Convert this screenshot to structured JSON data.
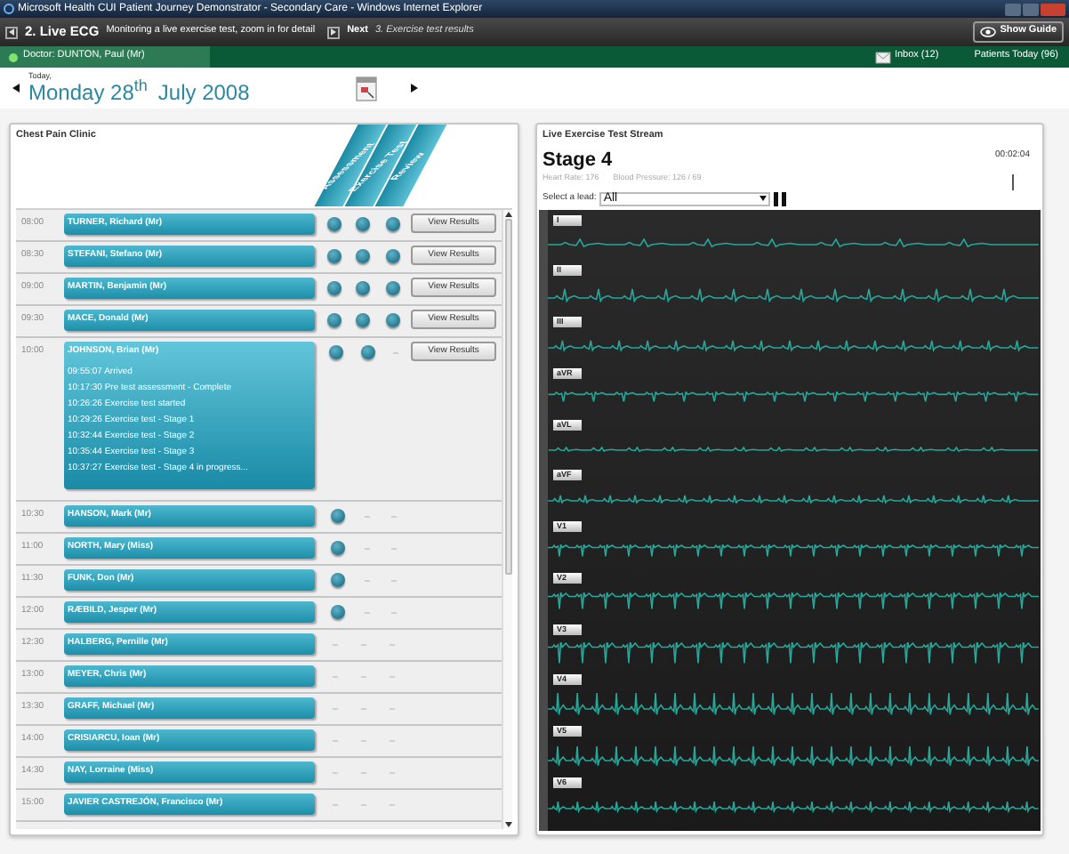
{
  "window": {
    "title": "Microsoft Health CUI Patient Journey Demonstrator - Secondary Care - Windows Internet Explorer"
  },
  "guide": {
    "step": "2. Live ECG",
    "description": "Monitoring a live exercise test, zoom in for detail",
    "next_label": "Next",
    "next_step": "3. Exercise test results",
    "show_guide": "Show Guide"
  },
  "status_bar": {
    "doctor": "Doctor: DUNTON, Paul (Mr)",
    "inbox": "Inbox (12)",
    "patients_today": "Patients Today (96)"
  },
  "date": {
    "today": "Today,",
    "day": "Monday 28$^{th}$",
    "month_year": "July 2008"
  },
  "clinic": {
    "title": "Chest Pain Clinic",
    "stages": [
      "Assessment",
      "Exercise Test",
      "Review"
    ],
    "appointments": [
      {
        "time": "08:00",
        "name": "TURNER, Richard (Mr)",
        "stages": [
          {
            "done": true
          },
          {
            "done": true
          },
          {
            "done": true
          }
        ],
        "action": "View Results",
        "expanded": false
      },
      {
        "time": "08:30",
        "name": "STEFANI, Stefano (Mr)",
        "stages": [
          {
            "done": true
          },
          {
            "done": true
          },
          {
            "done": true
          }
        ],
        "action": "View Results",
        "expanded": false
      },
      {
        "time": "09:00",
        "name": "MARTIN, Benjamin (Mr)",
        "stages": [
          {
            "done": true
          },
          {
            "done": true
          },
          {
            "done": true
          }
        ],
        "action": "View Results",
        "expanded": false
      },
      {
        "time": "09:30",
        "name": "MACE, Donald (Mr)",
        "stages": [
          {
            "done": true
          },
          {
            "done": true
          },
          {
            "done": true
          }
        ],
        "action": "View Results",
        "expanded": false
      },
      {
        "time": "10:00",
        "name": "JOHNSON, Brian (Mr)",
        "stages": [
          {
            "done": true
          },
          {
            "done": true
          },
          {
            "done": false
          }
        ],
        "action": "View Results",
        "expanded": true,
        "events": [
          "09:55:07 Arrived",
          "10:17:30 Pre test assessment - Complete",
          "10:26:26 Exercise test started",
          "10:29:26 Exercise test - Stage 1",
          "10:32:44 Exercise test - Stage 2",
          "10:35:44 Exercise test - Stage 3",
          "10:37:27 Exercise test - Stage 4 in progress..."
        ]
      },
      {
        "time": "10:30",
        "name": "HANSON, Mark (Mr)",
        "stages": [
          {
            "done": true
          },
          {
            "done": false
          },
          {
            "done": false
          }
        ],
        "expanded": false
      },
      {
        "time": "11:00",
        "name": "NORTH, Mary (Miss)",
        "stages": [
          {
            "done": true
          },
          {
            "done": false
          },
          {
            "done": false
          }
        ],
        "expanded": false
      },
      {
        "time": "11:30",
        "name": "FUNK, Don (Mr)",
        "stages": [
          {
            "done": true
          },
          {
            "done": false
          },
          {
            "done": false
          }
        ],
        "expanded": false
      },
      {
        "time": "12:00",
        "name": "RÆBILD, Jesper (Mr)",
        "stages": [
          {
            "done": true
          },
          {
            "done": false
          },
          {
            "done": false
          }
        ],
        "expanded": false
      },
      {
        "time": "12:30",
        "name": "HALBERG, Pernille (Mr)",
        "stages": [
          {
            "done": false
          },
          {
            "done": false
          },
          {
            "done": false
          }
        ],
        "expanded": false
      },
      {
        "time": "13:00",
        "name": "MEYER, Chris (Mr)",
        "stages": [
          {
            "done": false
          },
          {
            "done": false
          },
          {
            "done": false
          }
        ],
        "expanded": false
      },
      {
        "time": "13:30",
        "name": "GRAFF, Michael (Mr)",
        "stages": [
          {
            "done": false
          },
          {
            "done": false
          },
          {
            "done": false
          }
        ],
        "expanded": false
      },
      {
        "time": "14:00",
        "name": "CRISIARCU, Ioan (Mr)",
        "stages": [
          {
            "done": false
          },
          {
            "done": false
          },
          {
            "done": false
          }
        ],
        "expanded": false
      },
      {
        "time": "14:30",
        "name": "NAY, Lorraine (Miss)",
        "stages": [
          {
            "done": false
          },
          {
            "done": false
          },
          {
            "done": false
          }
        ],
        "expanded": false
      },
      {
        "time": "15:00",
        "name": "JAVIER CASTREJÓN, Francisco (Mr)",
        "stages": [
          {
            "done": false
          },
          {
            "done": false
          },
          {
            "done": false
          }
        ],
        "expanded": false
      }
    ]
  },
  "stream": {
    "title": "Live Exercise Test Stream",
    "stage": "Stage 4",
    "heart_rate": "Heart Rate: 176",
    "blood_pressure": "Blood Pressure: 126 / 69",
    "elapsed": "00:02:04",
    "lead_prompt": "Select a lead:",
    "lead_value": "All",
    "leads": [
      "I",
      "II",
      "III",
      "aVR",
      "aVL",
      "aVF",
      "V1",
      "V2",
      "V3",
      "V4",
      "V5",
      "V6"
    ]
  }
}
